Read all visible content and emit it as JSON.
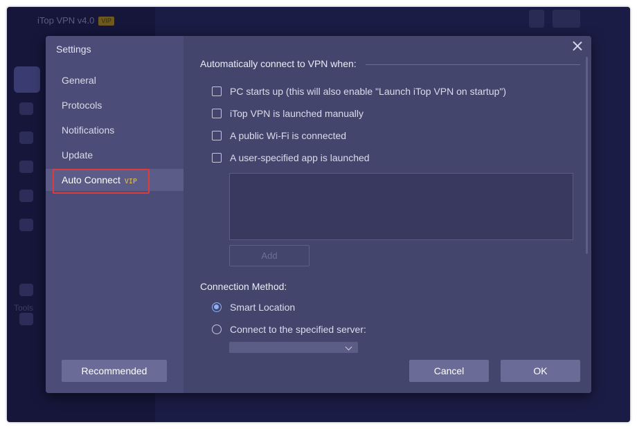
{
  "app": {
    "title": "iTop VPN v4.0",
    "vip_badge": "VIP",
    "tools_label": "Tools"
  },
  "dialog": {
    "title": "Settings",
    "nav": {
      "items": [
        {
          "label": "General"
        },
        {
          "label": "Protocols"
        },
        {
          "label": "Notifications"
        },
        {
          "label": "Update"
        },
        {
          "label": "Auto Connect",
          "tag": "VIP",
          "active": true
        }
      ],
      "recommended_label": "Recommended"
    },
    "auto_connect": {
      "section_title": "Automatically connect to VPN when:",
      "options": [
        {
          "label": "PC starts up (this will also enable \"Launch iTop VPN on startup\")",
          "checked": false
        },
        {
          "label": "iTop VPN is launched manually",
          "checked": false
        },
        {
          "label": "A public Wi-Fi is connected",
          "checked": false
        },
        {
          "label": "A user-specified app is launched",
          "checked": false
        }
      ],
      "add_label": "Add"
    },
    "connection_method": {
      "title": "Connection Method:",
      "options": [
        {
          "label": "Smart Location",
          "selected": true
        },
        {
          "label": "Connect to the specified server:",
          "selected": false
        }
      ]
    },
    "footer": {
      "cancel_label": "Cancel",
      "ok_label": "OK"
    }
  },
  "colors": {
    "accent_radio": "#8db0f7",
    "vip_tag": "#f0c24d",
    "highlight_box": "#e03b3b",
    "dialog_bg": "#43456d",
    "nav_bg": "#4b4d78"
  }
}
